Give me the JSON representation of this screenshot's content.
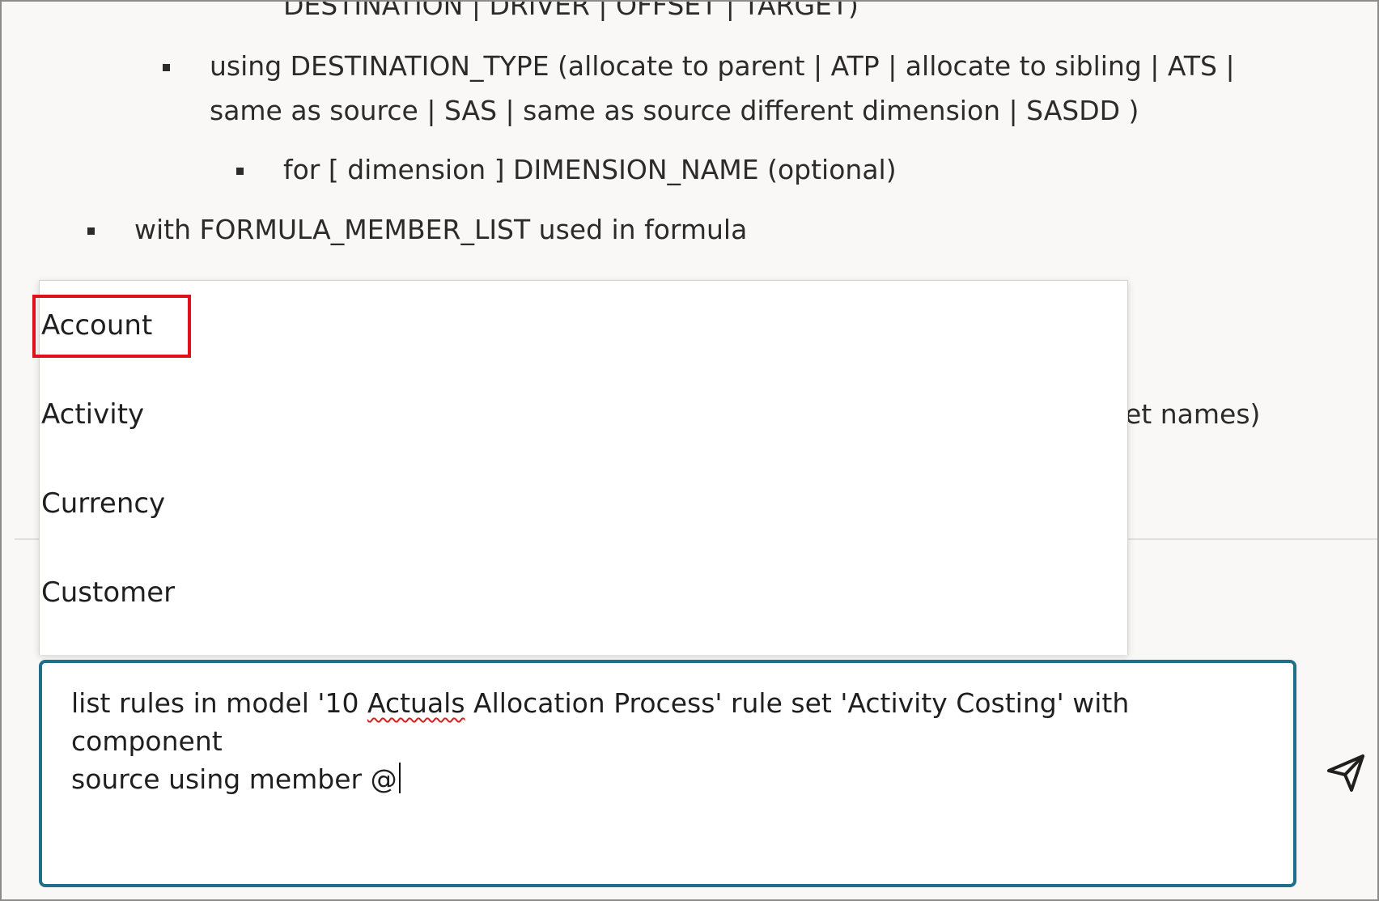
{
  "content": {
    "line_top_cut": "DESTINATION | DRIVER | OFFSET | TARGET)",
    "line_using_1": "using DESTINATION_TYPE (allocate to parent | ATP | allocate to sibling | ATS |",
    "line_using_2": "same as source | SAS | same as source different dimension | SASDD )",
    "line_for": "for [ dimension ] DIMENSION_NAME (optional)",
    "line_with": "with FORMULA_MEMBER_LIST used in formula",
    "line_hidden_partial": "et names)"
  },
  "dropdown": {
    "items": [
      {
        "label": "Account"
      },
      {
        "label": "Activity"
      },
      {
        "label": "Currency"
      },
      {
        "label": "Customer"
      }
    ]
  },
  "input": {
    "text_part1": "list rules in model '10 ",
    "text_misspelled": "Actuals",
    "text_part2": " Allocation Process' rule set 'Activity Costing' with component\nsource using member @"
  },
  "send": {
    "icon": "send-icon"
  }
}
